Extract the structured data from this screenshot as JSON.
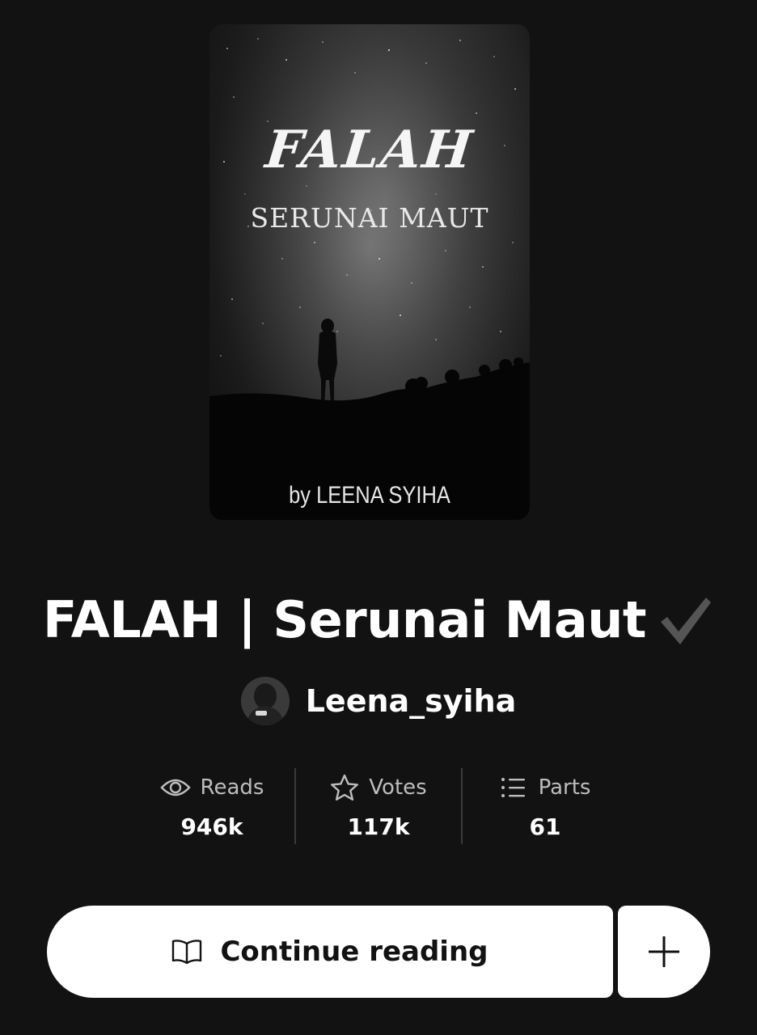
{
  "cover": {
    "title": "FALAH",
    "subtitle": "SERUNAI MAUT",
    "author_line": "by LEENA SYIHA"
  },
  "story": {
    "title": "FALAH | Serunai Maut",
    "completed_icon": "check-icon"
  },
  "author": {
    "name": "Leena_syiha",
    "avatar_icon": "avatar"
  },
  "stats": [
    {
      "icon": "eye-icon",
      "label": "Reads",
      "value": "946k"
    },
    {
      "icon": "star-icon",
      "label": "Votes",
      "value": "117k"
    },
    {
      "icon": "list-icon",
      "label": "Parts",
      "value": "61"
    }
  ],
  "actions": {
    "continue_label": "Continue reading",
    "continue_icon": "book-icon",
    "add_icon": "plus-icon"
  },
  "colors": {
    "background": "#121212",
    "button": "#ffffff",
    "muted_text": "#bdbdbd"
  }
}
